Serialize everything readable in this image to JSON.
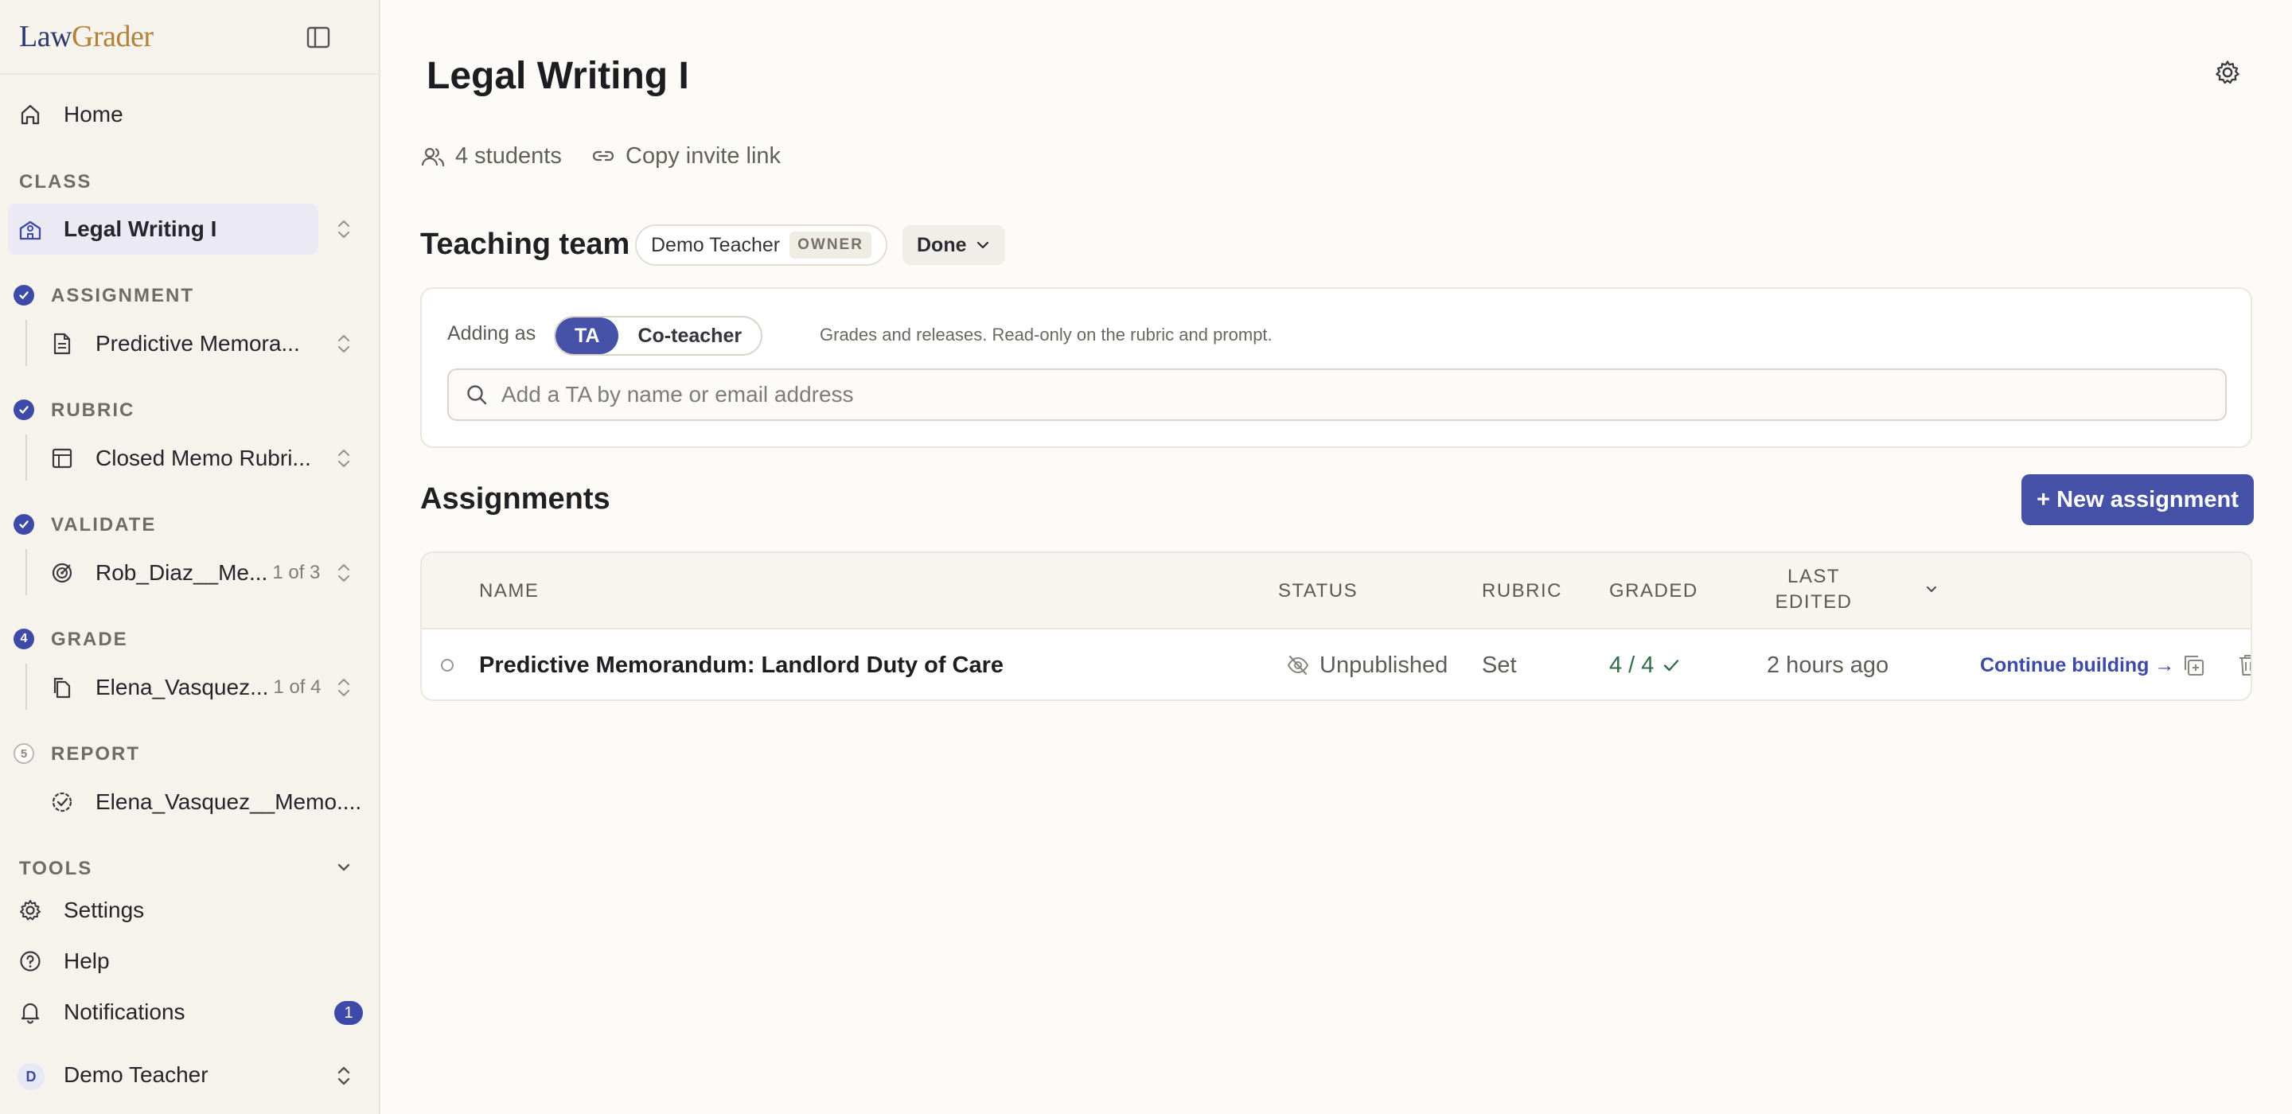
{
  "app": {
    "logo_part1": "Law",
    "logo_part2": "Grader"
  },
  "sidebar": {
    "home_label": "Home",
    "class_section": "CLASS",
    "class_name": "Legal Writing I",
    "steps": [
      {
        "section": "ASSIGNMENT",
        "status": "done",
        "item": "Predictive Memora...",
        "count": ""
      },
      {
        "section": "RUBRIC",
        "status": "done",
        "item": "Closed Memo Rubri...",
        "count": ""
      },
      {
        "section": "VALIDATE",
        "status": "done",
        "item": "Rob_Diaz__Me...",
        "count": "1 of 3"
      },
      {
        "section": "GRADE",
        "status": "active",
        "number": "4",
        "item": "Elena_Vasquez...",
        "count": "1 of 4"
      },
      {
        "section": "REPORT",
        "status": "pending",
        "number": "5",
        "item": "Elena_Vasquez__Memo....",
        "count": ""
      }
    ],
    "tools_section": "TOOLS",
    "tools": [
      {
        "label": "Settings",
        "icon": "gear-icon"
      },
      {
        "label": "Help",
        "icon": "help-circle-icon"
      },
      {
        "label": "Notifications",
        "icon": "bell-icon",
        "badge": "1"
      }
    ],
    "user": {
      "initial": "D",
      "name": "Demo Teacher"
    }
  },
  "main": {
    "title": "Legal Writing I",
    "students_label": "4 students",
    "invite_label": "Copy invite link",
    "teaching_team": {
      "heading": "Teaching team",
      "owner_name": "Demo Teacher",
      "owner_tag": "OWNER",
      "done_label": "Done",
      "adding_as_label": "Adding as",
      "role_options": [
        "TA",
        "Co-teacher"
      ],
      "selected_role": "TA",
      "role_description": "Grades and releases. Read-only on the rubric and prompt.",
      "search_placeholder": "Add a TA by name or email address",
      "search_value": ""
    },
    "assignments": {
      "heading": "Assignments",
      "new_button": "+ New assignment",
      "columns": {
        "name": "NAME",
        "status": "STATUS",
        "rubric": "RUBRIC",
        "graded": "GRADED",
        "last_edited_1": "LAST",
        "last_edited_2": "EDITED"
      },
      "rows": [
        {
          "name": "Predictive Memorandum: Landlord Duty of Care",
          "status": "Unpublished",
          "rubric": "Set",
          "graded": "4 / 4",
          "last_edited": "2 hours ago",
          "action": "Continue building →"
        }
      ]
    }
  },
  "colors": {
    "accent": "#4651a8",
    "graded_green": "#2f6b46",
    "link": "#3d4aa7",
    "logo_gold": "#b0823a",
    "logo_navy": "#2e3a6e"
  }
}
